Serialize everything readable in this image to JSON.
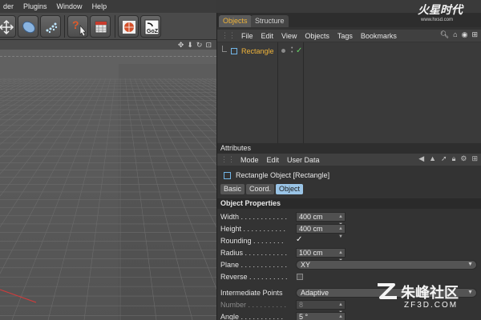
{
  "menubar": {
    "items": [
      "der",
      "Plugins",
      "Window",
      "Help"
    ]
  },
  "toolbar": {
    "icons": [
      "move-icon",
      "brush-icon",
      "particles-icon",
      "help-cursor-icon",
      "calculator-icon",
      "render-globe-icon",
      "goz-icon"
    ],
    "goz_label": "GoZ"
  },
  "viewport": {
    "nav_icons": [
      "move-view-icon",
      "arrow-down-icon",
      "refresh-icon",
      "maximize-icon"
    ]
  },
  "object_manager": {
    "tabs": [
      "Objects",
      "Structure"
    ],
    "menu": [
      "File",
      "Edit",
      "View",
      "Objects",
      "Tags",
      "Bookmarks"
    ],
    "objects": [
      {
        "name": "Rectangle"
      }
    ]
  },
  "attributes": {
    "header": "Attributes",
    "menu": [
      "Mode",
      "Edit",
      "User Data"
    ],
    "object_title": "Rectangle Object [Rectangle]",
    "tabs": [
      "Basic",
      "Coord.",
      "Object"
    ],
    "active_tab": "Object",
    "section": "Object Properties",
    "props": {
      "width": {
        "label": "Width . . . . . . . . . . . .",
        "value": "400 cm"
      },
      "height": {
        "label": "Height . . . . . . . . . . .",
        "value": "400 cm"
      },
      "rounding": {
        "label": "Rounding . . . . . . . .",
        "checked": true
      },
      "radius": {
        "label": "Radius . . . . . . . . . . .",
        "value": "100 cm"
      },
      "plane": {
        "label": "Plane . . . . . . . . . . . .",
        "value": "XY"
      },
      "reverse": {
        "label": "Reverse . . . . . . . . . .",
        "checked": false
      },
      "intermediate": {
        "label": "Intermediate Points",
        "value": "Adaptive"
      },
      "number": {
        "label": "Number . . . . . . . . . .",
        "value": "8"
      },
      "angle": {
        "label": "Angle . . . . . . . . . . .",
        "value": "5 °"
      }
    }
  },
  "watermarks": {
    "top_logo": "火星时代",
    "top_url": "www.hxsd.com",
    "bottom_cn": "朱峰社区",
    "bottom_en": "ZF3D.COM"
  },
  "colors": {
    "accent_orange": "#f0b43a",
    "accent_blue": "#9ac4e6",
    "check_green": "#66d766",
    "axis_red": "#d93a3a"
  }
}
